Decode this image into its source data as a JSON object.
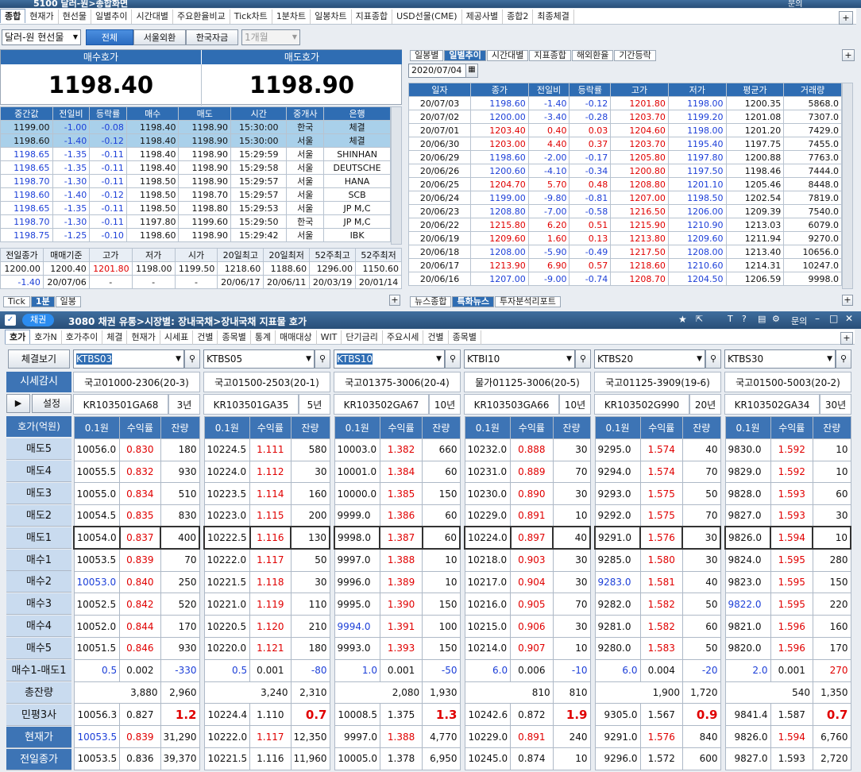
{
  "top_window": {
    "title": "5100 달러-원>종합화면",
    "tabs": [
      "종합",
      "현재가",
      "현선물",
      "일별추이",
      "시간대별",
      "주요환율비교",
      "Tick차트",
      "1분차트",
      "일봉차트",
      "지표종합",
      "USD선물(CME)",
      "제공사별",
      "종합2",
      "최종체결"
    ],
    "help": "문의"
  },
  "controls": {
    "product": "달러-원 현선물",
    "filters": [
      "전체",
      "서울외환",
      "한국자금"
    ],
    "period": "1개월"
  },
  "quote": {
    "bid_label": "매수호가",
    "ask_label": "매도호가",
    "bid": "1198.40",
    "ask": "1198.90"
  },
  "tick_table": {
    "headers": [
      "중간값",
      "전일비",
      "등락률",
      "매수",
      "매도",
      "시간",
      "중개사",
      "은행"
    ],
    "rows": [
      [
        "1199.00",
        "-1.00",
        "-0.08",
        "1198.40",
        "1198.90",
        "15:30:00",
        "한국",
        "체결"
      ],
      [
        "1198.60",
        "-1.40",
        "-0.12",
        "1198.40",
        "1198.90",
        "15:30:00",
        "서울",
        "체결"
      ],
      [
        "1198.65",
        "-1.35",
        "-0.11",
        "1198.40",
        "1198.90",
        "15:29:59",
        "서울",
        "SHINHAN"
      ],
      [
        "1198.65",
        "-1.35",
        "-0.11",
        "1198.40",
        "1198.90",
        "15:29:58",
        "서울",
        "DEUTSCHE"
      ],
      [
        "1198.70",
        "-1.30",
        "-0.11",
        "1198.50",
        "1198.90",
        "15:29:57",
        "서울",
        "HANA"
      ],
      [
        "1198.60",
        "-1.40",
        "-0.12",
        "1198.50",
        "1198.70",
        "15:29:57",
        "서울",
        "SCB"
      ],
      [
        "1198.65",
        "-1.35",
        "-0.11",
        "1198.50",
        "1198.80",
        "15:29:53",
        "서울",
        "JP M,C"
      ],
      [
        "1198.70",
        "-1.30",
        "-0.11",
        "1197.80",
        "1199.60",
        "15:29:50",
        "한국",
        "JP M,C"
      ],
      [
        "1198.75",
        "-1.25",
        "-0.10",
        "1198.60",
        "1198.90",
        "15:29:42",
        "서울",
        "IBK"
      ]
    ]
  },
  "summary": {
    "headers": [
      "전일종가",
      "매매기준",
      "고가",
      "저가",
      "시가",
      "20일최고",
      "20일최저",
      "52주최고",
      "52주최저"
    ],
    "row1": [
      "1200.00",
      "1200.40",
      "1201.80",
      "1198.00",
      "1199.50",
      "1218.60",
      "1188.60",
      "1296.00",
      "1150.60"
    ],
    "row2": [
      "-1.40",
      "20/07/06",
      "-",
      "-",
      "-",
      "20/06/17",
      "20/06/11",
      "20/03/19",
      "20/01/14"
    ]
  },
  "bottom_tabs_left": [
    "Tick",
    "1분",
    "일봉"
  ],
  "daily": {
    "tabs": [
      "일봉별",
      "일별추이",
      "시간대별",
      "지표종합",
      "해외환율",
      "기간등락"
    ],
    "date": "2020/07/04",
    "headers": [
      "일자",
      "종가",
      "전일비",
      "등락률",
      "고가",
      "저가",
      "평균가",
      "거래량"
    ],
    "rows": [
      [
        "20/07/03",
        "1198.60",
        "-1.40",
        "-0.12",
        "1201.80",
        "1198.00",
        "1200.35",
        "5868.0"
      ],
      [
        "20/07/02",
        "1200.00",
        "-3.40",
        "-0.28",
        "1203.70",
        "1199.20",
        "1201.08",
        "7307.0"
      ],
      [
        "20/07/01",
        "1203.40",
        "0.40",
        "0.03",
        "1204.60",
        "1198.00",
        "1201.20",
        "7429.0"
      ],
      [
        "20/06/30",
        "1203.00",
        "4.40",
        "0.37",
        "1203.70",
        "1195.40",
        "1197.75",
        "7455.0"
      ],
      [
        "20/06/29",
        "1198.60",
        "-2.00",
        "-0.17",
        "1205.80",
        "1197.80",
        "1200.88",
        "7763.0"
      ],
      [
        "20/06/26",
        "1200.60",
        "-4.10",
        "-0.34",
        "1200.80",
        "1197.50",
        "1198.46",
        "7444.0"
      ],
      [
        "20/06/25",
        "1204.70",
        "5.70",
        "0.48",
        "1208.80",
        "1201.10",
        "1205.46",
        "8448.0"
      ],
      [
        "20/06/24",
        "1199.00",
        "-9.80",
        "-0.81",
        "1207.00",
        "1198.50",
        "1202.54",
        "7819.0"
      ],
      [
        "20/06/23",
        "1208.80",
        "-7.00",
        "-0.58",
        "1216.50",
        "1206.00",
        "1209.39",
        "7540.0"
      ],
      [
        "20/06/22",
        "1215.80",
        "6.20",
        "0.51",
        "1215.90",
        "1210.90",
        "1213.03",
        "6079.0"
      ],
      [
        "20/06/19",
        "1209.60",
        "1.60",
        "0.13",
        "1213.80",
        "1209.60",
        "1211.94",
        "9270.0"
      ],
      [
        "20/06/18",
        "1208.00",
        "-5.90",
        "-0.49",
        "1217.50",
        "1208.00",
        "1213.40",
        "10656.0"
      ],
      [
        "20/06/17",
        "1213.90",
        "6.90",
        "0.57",
        "1218.60",
        "1210.60",
        "1214.31",
        "10247.0"
      ],
      [
        "20/06/16",
        "1207.00",
        "-9.00",
        "-0.74",
        "1208.70",
        "1204.50",
        "1206.59",
        "9998.0"
      ]
    ]
  },
  "news_tabs": [
    "뉴스종합",
    "특화뉴스",
    "투자분석리포트"
  ],
  "bond_window": {
    "badge": "채권",
    "title": "3080 채권 유통>시장별: 장내국채>장내국채 지표물 호가",
    "help": "문의",
    "tabs": [
      "호가",
      "호가N",
      "호가추이",
      "체결",
      "현재가",
      "시세표",
      "건별",
      "종목별",
      "통계",
      "매매대상",
      "WIT",
      "단기금리",
      "주요시세",
      "건별",
      "종목별"
    ],
    "left_buttons": {
      "trade": "체결보기",
      "price": "시세감시",
      "play": "▶",
      "setup": "설정",
      "quote_unit": "호가(억원)"
    },
    "row_labels": [
      "매도5",
      "매도4",
      "매도3",
      "매도2",
      "매도1",
      "매수1",
      "매수2",
      "매수3",
      "매수4",
      "매수5",
      "매수1-매도1",
      "총잔량",
      "민평3사",
      "현재가",
      "전일종가"
    ],
    "col_headers": [
      "0.1원",
      "수익률",
      "잔량"
    ]
  },
  "bonds": [
    {
      "code": "KTBS03",
      "name": "국고01000-2306(20-3)",
      "isin": "KR103501GA68",
      "term": "3년",
      "ask": [
        [
          "10056.0",
          "0.830",
          "180"
        ],
        [
          "10055.5",
          "0.832",
          "930"
        ],
        [
          "10055.0",
          "0.834",
          "510"
        ],
        [
          "10054.5",
          "0.835",
          "830"
        ],
        [
          "10054.0",
          "0.837",
          "400"
        ]
      ],
      "bid": [
        [
          "10053.5",
          "0.839",
          "70"
        ],
        [
          "10053.0",
          "0.840",
          "250"
        ],
        [
          "10052.5",
          "0.842",
          "520"
        ],
        [
          "10052.0",
          "0.844",
          "170"
        ],
        [
          "10051.5",
          "0.846",
          "930"
        ]
      ],
      "spread": [
        "0.5",
        "0.002",
        "-330"
      ],
      "total": [
        "3,880",
        "2,960"
      ],
      "mp": [
        "10056.3",
        "0.827",
        "1.2"
      ],
      "cur": [
        "10053.5",
        "0.839",
        "31,290"
      ],
      "prev": [
        "10053.5",
        "0.836",
        "39,370"
      ]
    },
    {
      "code": "KTBS05",
      "name": "국고01500-2503(20-1)",
      "isin": "KR103501GA35",
      "term": "5년",
      "ask": [
        [
          "10224.5",
          "1.111",
          "580"
        ],
        [
          "10224.0",
          "1.112",
          "30"
        ],
        [
          "10223.5",
          "1.114",
          "160"
        ],
        [
          "10223.0",
          "1.115",
          "200"
        ],
        [
          "10222.5",
          "1.116",
          "130"
        ]
      ],
      "bid": [
        [
          "10222.0",
          "1.117",
          "50"
        ],
        [
          "10221.5",
          "1.118",
          "30"
        ],
        [
          "10221.0",
          "1.119",
          "110"
        ],
        [
          "10220.5",
          "1.120",
          "210"
        ],
        [
          "10220.0",
          "1.121",
          "180"
        ]
      ],
      "spread": [
        "0.5",
        "0.001",
        "-80"
      ],
      "total": [
        "3,240",
        "2,310"
      ],
      "mp": [
        "10224.4",
        "1.110",
        "0.7"
      ],
      "cur": [
        "10222.0",
        "1.117",
        "12,350"
      ],
      "prev": [
        "10221.5",
        "1.116",
        "11,960"
      ]
    },
    {
      "code": "KTBS10",
      "name": "국고01375-3006(20-4)",
      "isin": "KR103502GA67",
      "term": "10년",
      "ask": [
        [
          "10003.0",
          "1.382",
          "660"
        ],
        [
          "10001.0",
          "1.384",
          "60"
        ],
        [
          "10000.0",
          "1.385",
          "150"
        ],
        [
          "9999.0",
          "1.386",
          "60"
        ],
        [
          "9998.0",
          "1.387",
          "60"
        ]
      ],
      "bid": [
        [
          "9997.0",
          "1.388",
          "10"
        ],
        [
          "9996.0",
          "1.389",
          "10"
        ],
        [
          "9995.0",
          "1.390",
          "150"
        ],
        [
          "9994.0",
          "1.391",
          "100"
        ],
        [
          "9993.0",
          "1.393",
          "150"
        ]
      ],
      "spread": [
        "1.0",
        "0.001",
        "-50"
      ],
      "total": [
        "2,080",
        "1,930"
      ],
      "mp": [
        "10008.5",
        "1.375",
        "1.3"
      ],
      "cur": [
        "9997.0",
        "1.388",
        "4,770"
      ],
      "prev": [
        "10005.0",
        "1.378",
        "6,950"
      ]
    },
    {
      "code": "KTBI10",
      "name": "물가01125-3006(20-5)",
      "isin": "KR103503GA66",
      "term": "10년",
      "ask": [
        [
          "10232.0",
          "0.888",
          "30"
        ],
        [
          "10231.0",
          "0.889",
          "70"
        ],
        [
          "10230.0",
          "0.890",
          "30"
        ],
        [
          "10229.0",
          "0.891",
          "10"
        ],
        [
          "10224.0",
          "0.897",
          "40"
        ]
      ],
      "bid": [
        [
          "10218.0",
          "0.903",
          "30"
        ],
        [
          "10217.0",
          "0.904",
          "30"
        ],
        [
          "10216.0",
          "0.905",
          "70"
        ],
        [
          "10215.0",
          "0.906",
          "30"
        ],
        [
          "10214.0",
          "0.907",
          "10"
        ]
      ],
      "spread": [
        "6.0",
        "0.006",
        "-10"
      ],
      "total": [
        "810",
        "810"
      ],
      "mp": [
        "10242.6",
        "0.872",
        "1.9"
      ],
      "cur": [
        "10229.0",
        "0.891",
        "240"
      ],
      "prev": [
        "10245.0",
        "0.874",
        "10"
      ]
    },
    {
      "code": "KTBS20",
      "name": "국고01125-3909(19-6)",
      "isin": "KR103502G990",
      "term": "20년",
      "ask": [
        [
          "9295.0",
          "1.574",
          "40"
        ],
        [
          "9294.0",
          "1.574",
          "70"
        ],
        [
          "9293.0",
          "1.575",
          "50"
        ],
        [
          "9292.0",
          "1.575",
          "70"
        ],
        [
          "9291.0",
          "1.576",
          "30"
        ]
      ],
      "bid": [
        [
          "9285.0",
          "1.580",
          "30"
        ],
        [
          "9283.0",
          "1.581",
          "40"
        ],
        [
          "9282.0",
          "1.582",
          "50"
        ],
        [
          "9281.0",
          "1.582",
          "60"
        ],
        [
          "9280.0",
          "1.583",
          "50"
        ]
      ],
      "spread": [
        "6.0",
        "0.004",
        "-20"
      ],
      "total": [
        "1,900",
        "1,720"
      ],
      "mp": [
        "9305.0",
        "1.567",
        "0.9"
      ],
      "cur": [
        "9291.0",
        "1.576",
        "840"
      ],
      "prev": [
        "9296.0",
        "1.572",
        "600"
      ]
    },
    {
      "code": "KTBS30",
      "name": "국고01500-5003(20-2)",
      "isin": "KR103502GA34",
      "term": "30년",
      "ask": [
        [
          "9830.0",
          "1.592",
          "10"
        ],
        [
          "9829.0",
          "1.592",
          "10"
        ],
        [
          "9828.0",
          "1.593",
          "60"
        ],
        [
          "9827.0",
          "1.593",
          "30"
        ],
        [
          "9826.0",
          "1.594",
          "10"
        ]
      ],
      "bid": [
        [
          "9824.0",
          "1.595",
          "280"
        ],
        [
          "9823.0",
          "1.595",
          "150"
        ],
        [
          "9822.0",
          "1.595",
          "220"
        ],
        [
          "9821.0",
          "1.596",
          "160"
        ],
        [
          "9820.0",
          "1.596",
          "170"
        ]
      ],
      "spread": [
        "2.0",
        "0.001",
        "270"
      ],
      "total": [
        "540",
        "1,350"
      ],
      "mp": [
        "9841.4",
        "1.587",
        "0.7"
      ],
      "cur": [
        "9826.0",
        "1.594",
        "6,760"
      ],
      "prev": [
        "9827.0",
        "1.593",
        "2,720"
      ]
    }
  ]
}
